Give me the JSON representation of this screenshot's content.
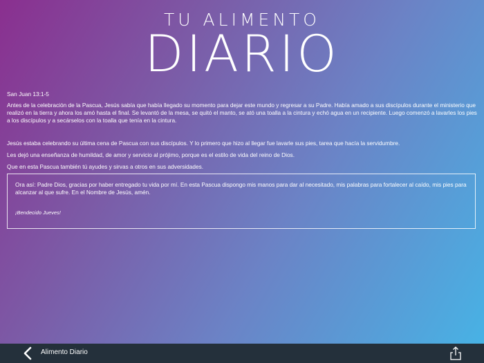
{
  "header": {
    "title_top": "TU ALIMENTO",
    "title_main": "DIARIO"
  },
  "content": {
    "reference": "San Juan 13:1-5",
    "paragraphs": [
      "Antes de la celebración de la Pascua, Jesús sabía que había llegado su momento para dejar este mundo y regresar a su Padre. Había amado a sus discípulos durante el ministerio que realizó en la tierra y ahora los amó hasta el final. Se levantó de la mesa, se quitó el manto, se ató una toalla a la cintura y echó agua en un recipiente. Luego comenzó a lavarles los pies a los discípulos y a secárselos con la toalla que tenía en la cintura.",
      "Jesús estaba celebrando su última cena de Pascua con sus discípulos. Y lo primero que hizo  al llegar fue lavarle sus pies, tarea que hacía la servidumbre.",
      "Les dejó una enseñanza de humildad, de amor y servicio al prójimo, porque es el estilo de vida del reino de Dios.",
      "Que en esta Pascua también tú ayudes y sirvas a otros en sus adversidades."
    ]
  },
  "prayer": {
    "text": "Ora así: Padre Dios, gracias por haber entregado  tu vida por mí. En esta Pascua dispongo mis manos para dar al necesitado, mis palabras para fortalecer al caído, mis pies para alcanzar al que sufre. En el Nombre de Jesús, amén.",
    "closing": "¡Bendecido Jueves!"
  },
  "bottom_bar": {
    "title": "Alimento Diario",
    "back_icon": "chevron-left-icon",
    "share_icon": "share-icon"
  }
}
